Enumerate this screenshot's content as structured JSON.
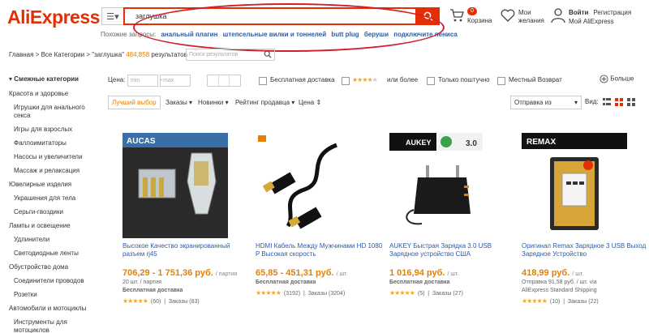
{
  "header": {
    "logo": "AliExpress",
    "search_value": "заглушка",
    "related_label": "Похожие запросы:",
    "related": [
      "анальный плагин",
      "штепсельные вилки и тоннелей",
      "butt plug",
      "беруши",
      "подключите пениса"
    ],
    "cart_count": "0",
    "cart_label": "Корзина",
    "wish_l1": "Мои",
    "wish_l2": "желания",
    "login": "Войти",
    "register": "Регистрация",
    "my_ali": "Мой AliExpress"
  },
  "breadcrumb": {
    "home": "Главная",
    "sep": " > ",
    "all": "Все Категории",
    "query": "\"заглушка\"",
    "count": "484,858",
    "results": "результатов",
    "search_placeholder": "Поиск результатов"
  },
  "sidebar": {
    "title": "Смежные категории",
    "items": [
      {
        "label": "Красота и здоровье",
        "sub": false
      },
      {
        "label": "Игрушки для анального секса",
        "sub": true
      },
      {
        "label": "Игры для взрослых",
        "sub": true
      },
      {
        "label": "Фаллоимитаторы",
        "sub": true
      },
      {
        "label": "Насосы и увеличители",
        "sub": true
      },
      {
        "label": "Массаж и релаксация",
        "sub": true
      },
      {
        "label": "Ювелирные изделия",
        "sub": false
      },
      {
        "label": "Украшения для тела",
        "sub": true
      },
      {
        "label": "Серьги-гвоздики",
        "sub": true
      },
      {
        "label": "Лампы и освещение",
        "sub": false
      },
      {
        "label": "Удлинители",
        "sub": true
      },
      {
        "label": "Светодиодные ленты",
        "sub": true
      },
      {
        "label": "Обустройство дома",
        "sub": false
      },
      {
        "label": "Соединители проводов",
        "sub": true
      },
      {
        "label": "Розетки",
        "sub": true
      },
      {
        "label": "Автомобили и мотоциклы",
        "sub": false
      },
      {
        "label": "Инструменты для мотоциклов",
        "sub": true
      }
    ]
  },
  "filters": {
    "price": "Цена:",
    "min": "min",
    "dash": "-",
    "max": "max",
    "free_shipping": "Бесплатная доставка",
    "or_more": "или более",
    "only_new": "Только поштучно",
    "local_return": "Местный Возврат",
    "more": "Больше"
  },
  "sort": {
    "best": "Лучший выбор",
    "orders": "Заказы",
    "new": "Новинки",
    "seller_rating": "Рейтинг продавца",
    "price": "Цена",
    "ship_from": "Отправка из",
    "view": "Вид:"
  },
  "colors": {
    "accent": "#e62e04",
    "price": "#e68000",
    "link": "#2c5ca8",
    "star": "#f5a623"
  },
  "products": [
    {
      "title": "Высокое Качество экранированный разъем rj45",
      "price": "706,29 - 1 751,36 руб.",
      "unit": "/ партия",
      "sub1": "20 шт. / партия",
      "sub2": "Бесплатная доставка",
      "sub2_bold": true,
      "reviews": "(60)",
      "orders": "Заказы (83)",
      "stars": 5,
      "brand": "AUCAS"
    },
    {
      "title": "HDMI Кабель Между Мужчинами HD 1080 P Высокая скорость",
      "price": "65,85 - 451,31 руб.",
      "unit": "/ шт.",
      "sub1": "Бесплатная доставка",
      "sub1_bold": true,
      "sub2": "",
      "reviews": "(3192)",
      "orders": "Заказы (3204)",
      "stars": 5,
      "brand": ""
    },
    {
      "title": "AUKEY Быстрая Зарядка 3.0 USB Зарядное устройство США",
      "price": "1 016,94 руб.",
      "unit": "/ шт.",
      "sub1": "Бесплатная доставка",
      "sub1_bold": true,
      "sub2": "",
      "reviews": "(5)",
      "orders": "Заказы (27)",
      "stars": 5,
      "brand": "AUKEY",
      "badge": "3.0"
    },
    {
      "title": "Оригинал Remax Зарядное 3 USB Выход Зарядное Устройство",
      "price": "418,99 руб.",
      "unit": "/ шт.",
      "sub1": "Отправка 91,58 руб. / шт. via",
      "sub2": "AliExpress Standard Shipping",
      "reviews": "(10)",
      "orders": "Заказы (22)",
      "stars": 5,
      "brand": "REMAX"
    }
  ]
}
